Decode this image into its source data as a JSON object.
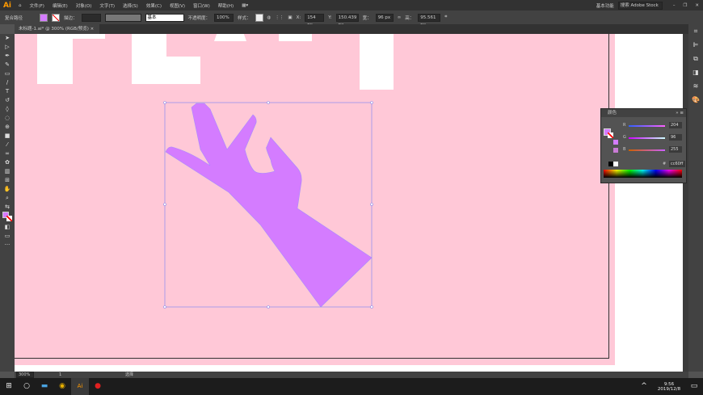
{
  "app": {
    "logo": "Ai"
  },
  "menu": [
    "文件(F)",
    "编辑(E)",
    "对象(O)",
    "文字(T)",
    "选择(S)",
    "效果(C)",
    "视图(V)",
    "窗口(W)",
    "帮助(H)"
  ],
  "workspace": "基本功能",
  "search_placeholder": "搜索 Adobe Stock",
  "control": {
    "selection": "复合路径",
    "stroke_label": "描边：",
    "stroke_style": "基本",
    "opacity_label": "不透明度：",
    "opacity": "100%",
    "style_label": "样式：",
    "x": "154 px",
    "y": "150.439 px",
    "w_label": "宽：",
    "w": "96 px",
    "h_label": "高：",
    "h": "95.561 px"
  },
  "fill_color": "#d47cff",
  "document_tab": "未标题-1.ai* @ 300% (RGB/预览)",
  "color_panel": {
    "title": "颜色",
    "r": "204",
    "g": "96",
    "b": "255",
    "hex": "cc60ff",
    "r_frac": 0.8,
    "g_frac": 0.376,
    "b_frac": 1.0
  },
  "status": {
    "zoom": "300%",
    "page": "1",
    "tool": "选择"
  },
  "taskbar": {
    "time": "9:56",
    "date": "2019/12/8"
  }
}
